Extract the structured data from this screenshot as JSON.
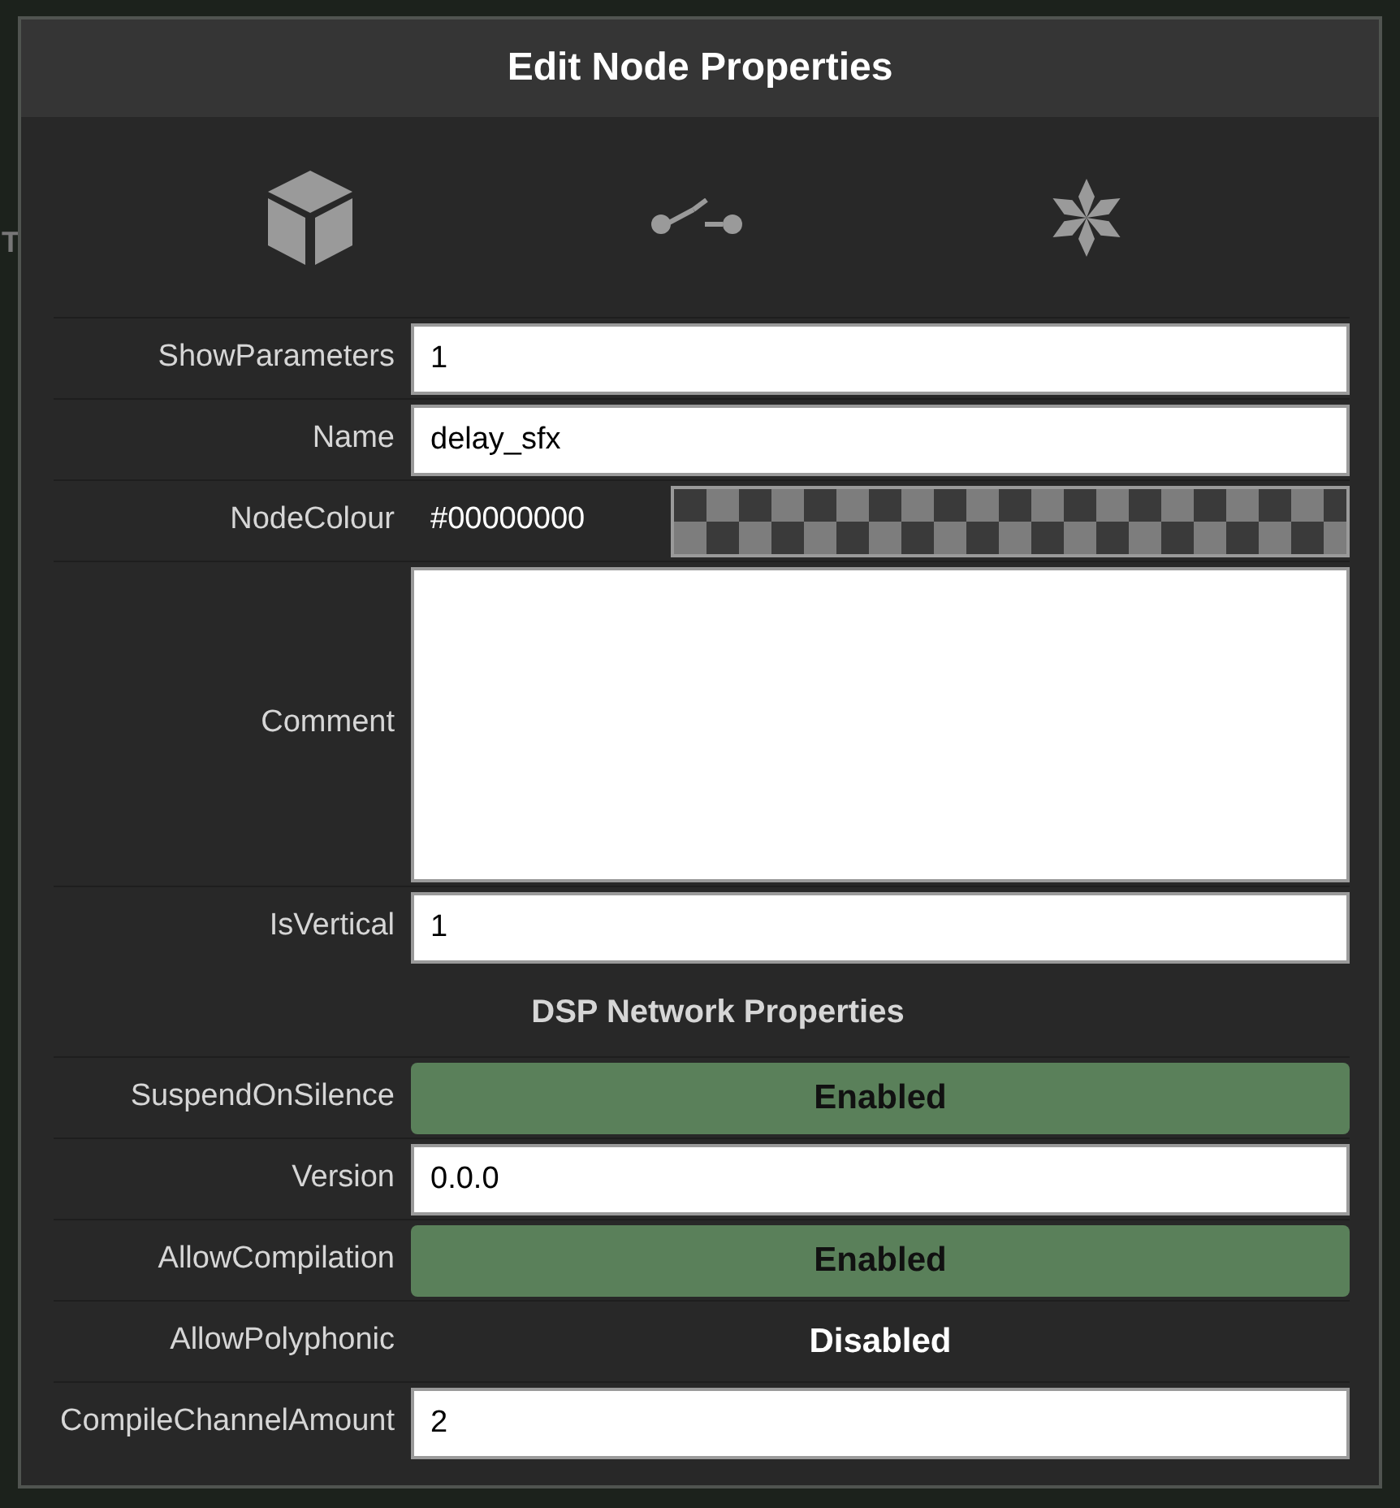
{
  "background_label": "T",
  "dialog": {
    "title": "Edit Node Properties",
    "rows": [
      {
        "kind": "text",
        "label": "ShowParameters",
        "value": "1"
      },
      {
        "kind": "text",
        "label": "Name",
        "value": "delay_sfx"
      },
      {
        "kind": "colour",
        "label": "NodeColour",
        "value": "#00000000"
      },
      {
        "kind": "textarea",
        "label": "Comment"
      },
      {
        "kind": "text",
        "label": "IsVertical",
        "value": "1"
      },
      {
        "kind": "heading",
        "label": "DSP Network Properties"
      },
      {
        "kind": "toggle",
        "label": "SuspendOnSilence",
        "value": "Enabled",
        "on": true
      },
      {
        "kind": "text",
        "label": "Version",
        "value": "0.0.0"
      },
      {
        "kind": "toggle",
        "label": "AllowCompilation",
        "value": "Enabled",
        "on": true
      },
      {
        "kind": "toggle",
        "label": "AllowPolyphonic",
        "value": "Disabled",
        "on": false
      },
      {
        "kind": "text",
        "label": "CompileChannelAmount",
        "value": "2"
      }
    ]
  }
}
